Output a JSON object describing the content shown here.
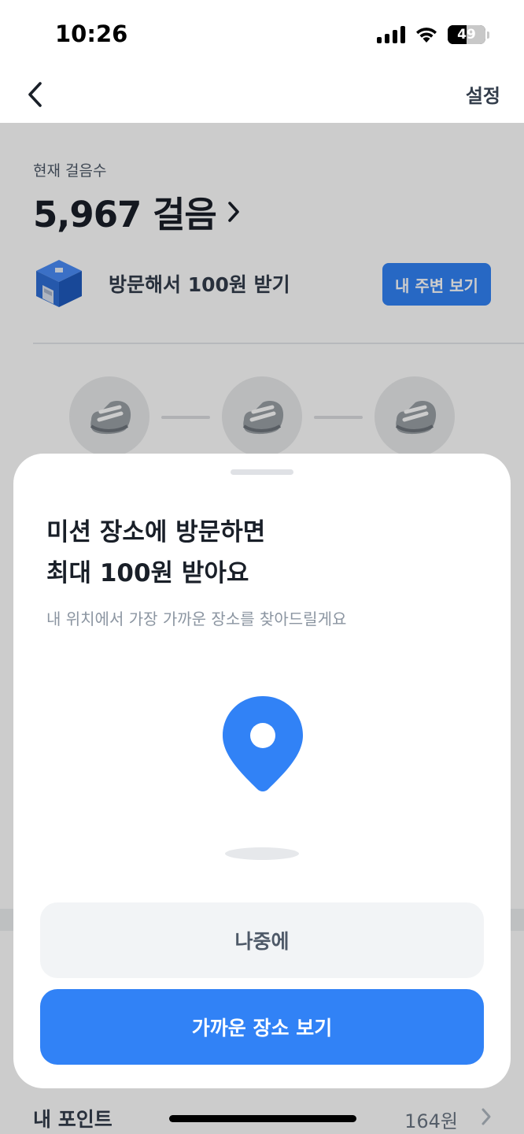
{
  "status_bar": {
    "time": "10:26",
    "battery": "49",
    "icons": [
      "signal-icon",
      "wifi-icon",
      "battery-icon"
    ]
  },
  "nav": {
    "back_icon": "chevron-left-icon",
    "settings_label": "설정"
  },
  "steps": {
    "current_label": "현재 걸음수",
    "value": "5,967 걸음"
  },
  "visit": {
    "label": "방문해서 100원 받기",
    "button_label": "내 주변 보기",
    "icon": "box-icon"
  },
  "shoes": {
    "icon": "shoe-icon",
    "count": 3
  },
  "points": {
    "label": "내 포인트",
    "value": "164원"
  },
  "sheet": {
    "title_line1": "미션 장소에 방문하면",
    "title_line2": "최대 100원 받아요",
    "subtitle": "내 위치에서 가장 가까운 장소를 찾아드릴게요",
    "pin_icon": "location-pin-icon",
    "later_button": "나중에",
    "nearest_button": "가까운 장소 보기"
  },
  "colors": {
    "accent": "#3182f6",
    "dim_overlay": "rgba(0,0,0,0.2)",
    "secondary_button_bg": "#f2f4f6"
  }
}
